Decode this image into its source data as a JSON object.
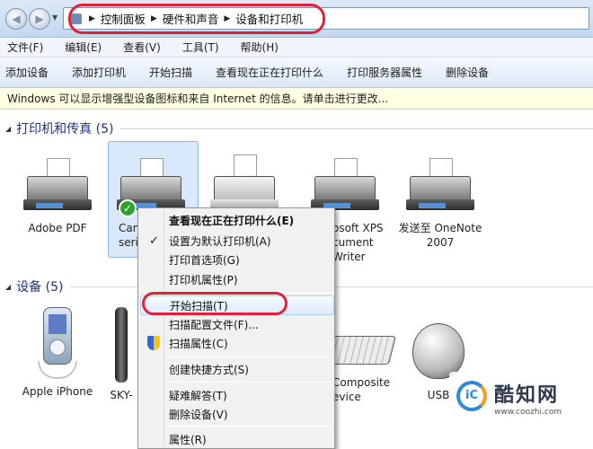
{
  "address_bar": {
    "breadcrumbs": [
      "控制面板",
      "硬件和声音",
      "设备和打印机"
    ]
  },
  "menu": [
    "文件(F)",
    "编辑(E)",
    "查看(V)",
    "工具(T)",
    "帮助(H)"
  ],
  "toolbar": [
    "添加设备",
    "添加打印机",
    "开始扫描",
    "查看现在正在打印什么",
    "打印服务器属性",
    "删除设备"
  ],
  "info_bar": "Windows 可以显示增强型设备图标和来自 Internet 的信息。请单击进行更改...",
  "printers_group": {
    "label": "打印机和传真 (5)",
    "items": [
      {
        "label": "Adobe PDF"
      },
      {
        "label": "Canc serie",
        "lines": [
          "Canc",
          "serie"
        ]
      },
      {
        "label": ""
      },
      {
        "label": "osoft XPS cument Writer",
        "lines": [
          "osoft XPS",
          "cument",
          "Writer"
        ]
      },
      {
        "label": "发送至 OneNote 2007",
        "lines": [
          "发送至 OneNote",
          "2007"
        ]
      }
    ]
  },
  "devices_group": {
    "label": "设备 (5)",
    "items": [
      {
        "label": "Apple iPhone"
      },
      {
        "label": "SKY-"
      },
      {
        "label": "Composite evice",
        "lines": [
          "Composite",
          "evice"
        ]
      },
      {
        "label": "USB"
      }
    ]
  },
  "context_menu": {
    "items": [
      {
        "label": "查看现在正在打印什么(E)",
        "bold": true
      },
      {
        "label": "设置为默认打印机(A)",
        "checked": true
      },
      {
        "label": "打印首选项(G)"
      },
      {
        "label": "打印机属性(P)"
      },
      {
        "label": "开始扫描(T)",
        "highlighted": true
      },
      {
        "label": "扫描配置文件(F)..."
      },
      {
        "label": "扫描属性(C)",
        "shield": true
      },
      {
        "label": "创建快捷方式(S)"
      },
      {
        "label": "疑难解答(T)"
      },
      {
        "label": "删除设备(V)"
      },
      {
        "label": "属性(R)"
      }
    ]
  },
  "watermark": {
    "logo_text": "iC",
    "name": "酷知网",
    "url": "www.coozhi.com"
  },
  "colors": {
    "annotation_red": "#e0213a",
    "group_header_blue": "#1e3287",
    "info_bar_yellow": "#ffffe1"
  }
}
